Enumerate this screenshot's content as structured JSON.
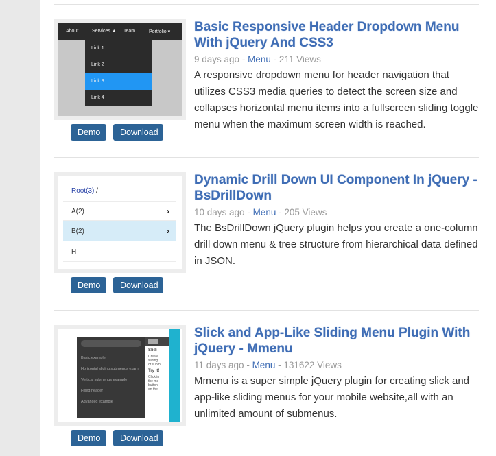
{
  "buttons": {
    "demo": "Demo",
    "download": "Download"
  },
  "items": [
    {
      "title": "Basic Responsive Header Dropdown Menu With jQuery And CSS3",
      "age": "9 days ago",
      "sep": " - ",
      "category": "Menu",
      "views": " - 211 Views",
      "description": "A responsive dropdown menu for header navigation that utilizes CSS3 media queries to detect the screen size and collapses horizontal menu items into a fullscreen sliding toggle menu when the maximum screen width is reached.",
      "thumb": {
        "nav": [
          "About",
          "Services ▲",
          "Team",
          "Portfolio ▾"
        ],
        "links": [
          "Link 1",
          "Link 2",
          "Link 3",
          "Link 4"
        ]
      }
    },
    {
      "title": "Dynamic Drill Down UI Component In jQuery - BsDrillDown",
      "age": "10 days ago",
      "sep": " - ",
      "category": "Menu",
      "views": " - 205 Views",
      "description": "The BsDrillDown jQuery plugin helps you create a one-column drill down menu & tree structure from hierarchical data defined in JSON.",
      "thumb": {
        "crumb_root": "Root(3)",
        "crumb_sep": " /",
        "rows": [
          "A(2)",
          "B(2)",
          "H"
        ]
      }
    },
    {
      "title": "Slick and App-Like Sliding Menu Plugin With jQuery - Mmenu",
      "age": "11 days ago",
      "sep": " - ",
      "category": "Menu",
      "views": " - 131622 Views",
      "description": "Mmenu is a super simple jQuery plugin for creating slick and app-like sliding menus for your mobile website,all with an unlimited amount of submenus.",
      "thumb": {
        "menu": [
          "Basic example",
          "Horizontal sliding submenus exam",
          "Vertical submenus example",
          "Fixed header",
          "Advanced example"
        ],
        "heading": "Slidi",
        "lines": [
          "Create",
          "sliding",
          "of subm"
        ],
        "heading2": "Try it!",
        "lines2": [
          "Click in",
          "the me",
          "button",
          "on the"
        ]
      }
    }
  ]
}
